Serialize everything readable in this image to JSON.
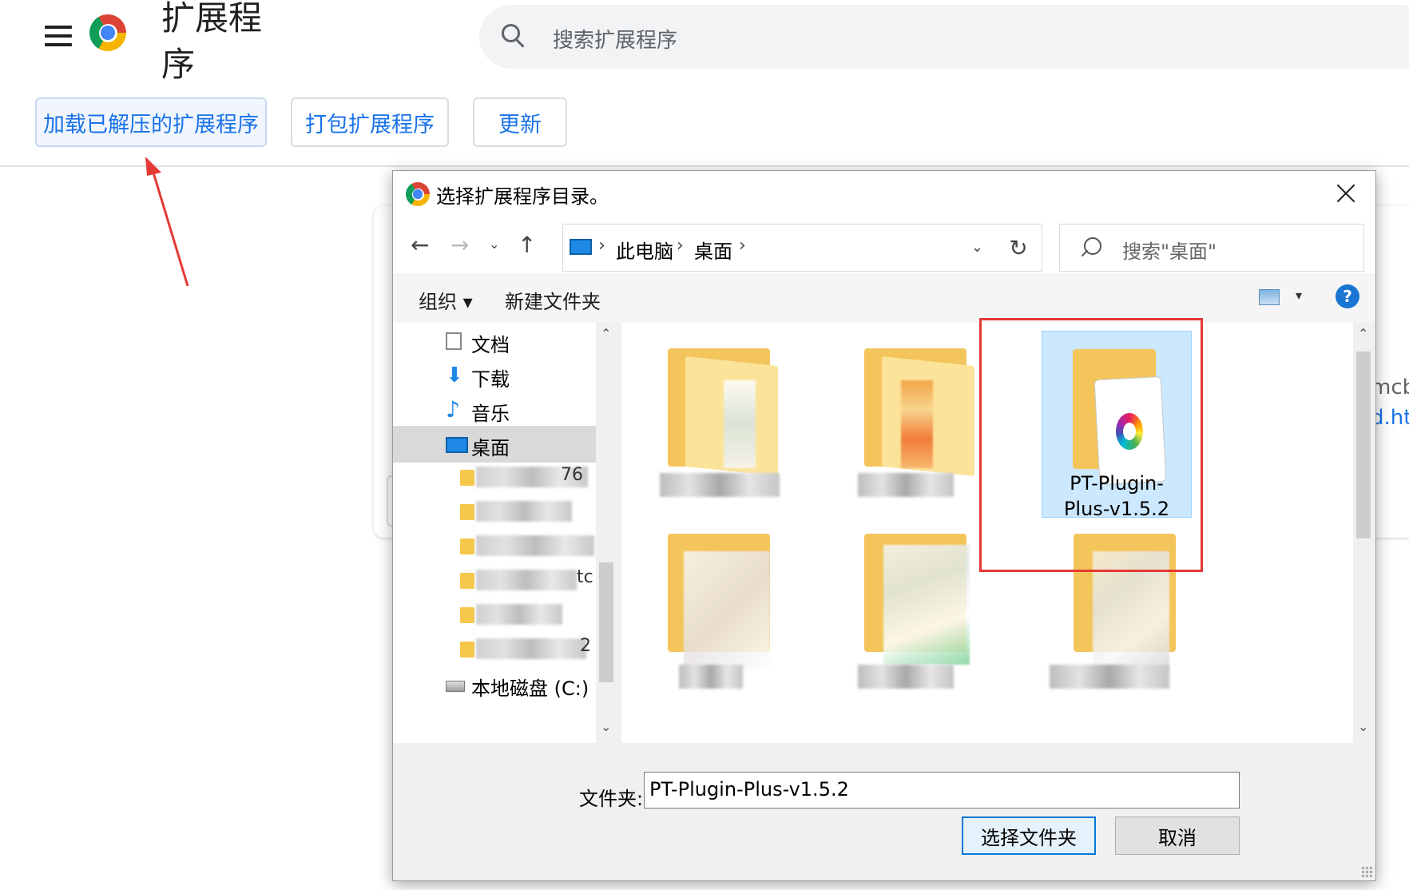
{
  "app": {
    "title": "扩展程序",
    "search_placeholder": "搜索扩展程序",
    "buttons": {
      "load_unpacked": "加载已解压的扩展程序",
      "pack": "打包扩展程序",
      "update": "更新"
    },
    "background_card": {
      "text_partial_1": "mcb",
      "text_partial_2": "d.htr"
    }
  },
  "dialog": {
    "title": "选择扩展程序目录。",
    "breadcrumb": [
      "此电脑",
      "桌面"
    ],
    "search_placeholder": "搜索\"桌面\"",
    "toolbar": {
      "organize": "组织 ▾",
      "new_folder": "新建文件夹",
      "help": "?"
    },
    "nav_items": [
      {
        "label": "文档",
        "icon": "document-icon"
      },
      {
        "label": "下载",
        "icon": "download-arrow-icon"
      },
      {
        "label": "音乐",
        "icon": "music-note-icon"
      },
      {
        "label": "桌面",
        "icon": "desktop-icon",
        "selected": true
      },
      {
        "label": "本地磁盘 (C:)",
        "icon": "drive-icon"
      }
    ],
    "subfolder_partial_text": [
      "76",
      "tc",
      "2"
    ],
    "selected_file": {
      "label": "PT-Plugin-Plus-v1.5.2"
    },
    "folder_field_label": "文件夹:",
    "folder_field_value": "PT-Plugin-Plus-v1.5.2",
    "select_button": "选择文件夹",
    "cancel_button": "取消"
  },
  "colors": {
    "accent_blue": "#1a73e8",
    "highlight_red": "#e53935",
    "selection_blue": "#cce8ff"
  }
}
